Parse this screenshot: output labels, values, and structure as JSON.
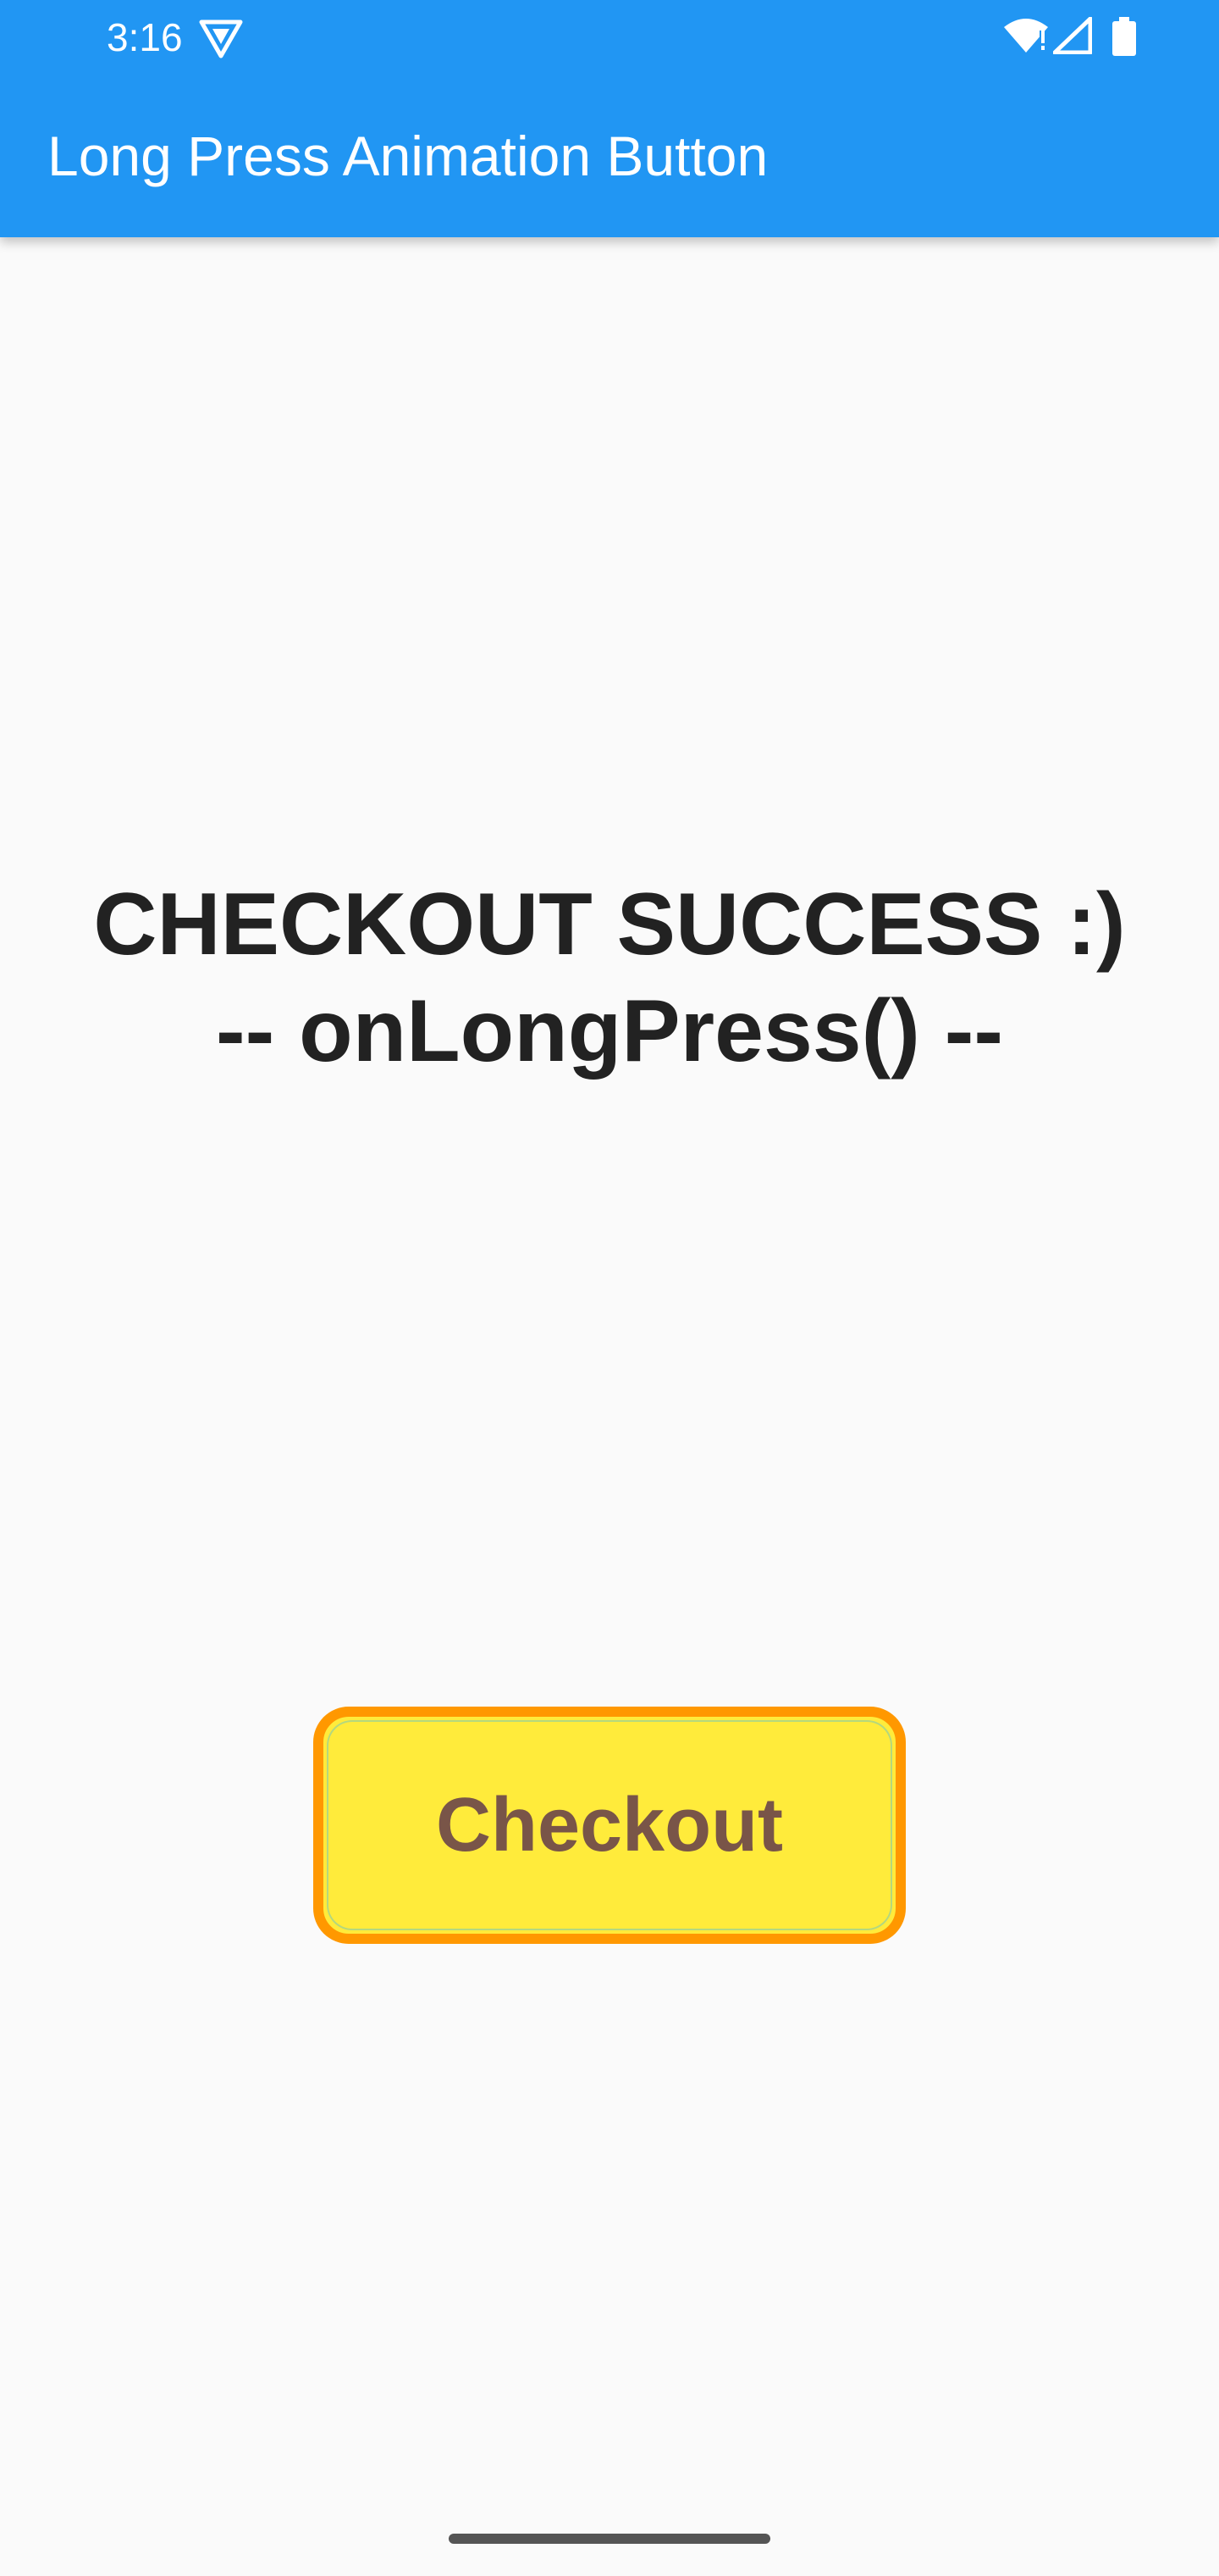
{
  "status_bar": {
    "time": "3:16",
    "icons": [
      "app-notification-icon",
      "wifi-icon",
      "signal-icon",
      "battery-icon"
    ]
  },
  "app_bar": {
    "title": "Long Press Animation Button",
    "color": "#2196f3"
  },
  "message": {
    "line1": "CHECKOUT SUCCESS :)",
    "line2": "-- onLongPress() --"
  },
  "checkout_button": {
    "label": "Checkout",
    "fill_color": "#ffeb3b",
    "border_color": "#ff9800",
    "text_color": "#795548"
  }
}
